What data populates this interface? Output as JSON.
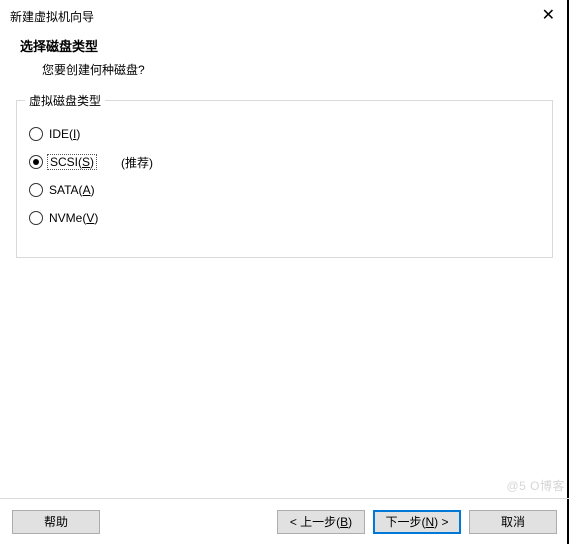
{
  "window": {
    "title": "新建虚拟机向导",
    "close_glyph": "✕"
  },
  "header": {
    "title": "选择磁盘类型",
    "subtitle": "您要创建何种磁盘?"
  },
  "group": {
    "legend": "虚拟磁盘类型",
    "recommend": "(推荐)"
  },
  "options": {
    "ide": {
      "prefix": "IDE(",
      "hot": "I",
      "suffix": ")"
    },
    "scsi": {
      "prefix": "SCSI(",
      "hot": "S",
      "suffix": ")"
    },
    "sata": {
      "prefix": "SATA(",
      "hot": "A",
      "suffix": ")"
    },
    "nvme": {
      "prefix": "NVMe(",
      "hot": "V",
      "suffix": ")"
    }
  },
  "buttons": {
    "help": "帮助",
    "back": {
      "prefix": "< 上一步(",
      "hot": "B",
      "suffix": ")"
    },
    "next": {
      "prefix": "下一步(",
      "hot": "N",
      "suffix": ") >"
    },
    "cancel": "取消"
  },
  "watermark": "@5    O博客"
}
